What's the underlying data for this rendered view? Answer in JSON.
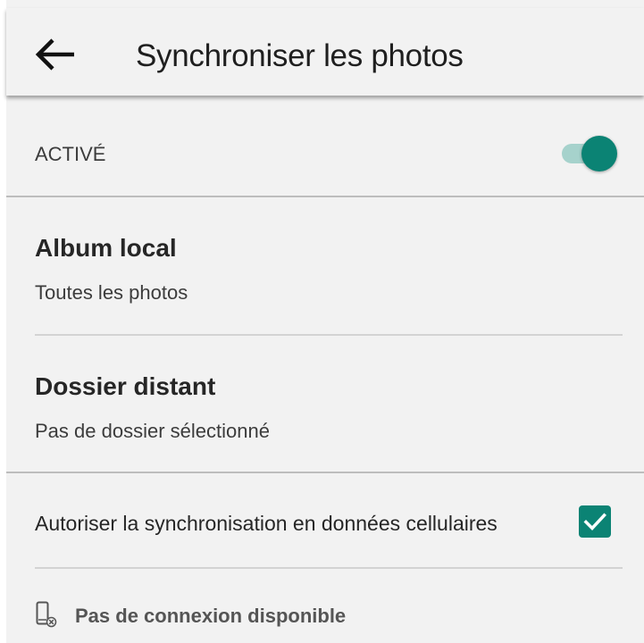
{
  "appbar": {
    "title": "Synchroniser les photos",
    "back_icon": "arrow-left-icon"
  },
  "enabled": {
    "label": "ACTIVÉ",
    "toggle_on": true,
    "accent_color": "#0b8374",
    "track_color": "#a6d2cc"
  },
  "local_album": {
    "title": "Album local",
    "value": "Toutes les photos"
  },
  "remote_folder": {
    "title": "Dossier distant",
    "value": "Pas de dossier sélectionné"
  },
  "cellular": {
    "label": "Autoriser la synchronisation en données cellulaires",
    "checked": true
  },
  "status": {
    "icon": "phone-no-connection-icon",
    "text": "Pas de connexion disponible"
  }
}
